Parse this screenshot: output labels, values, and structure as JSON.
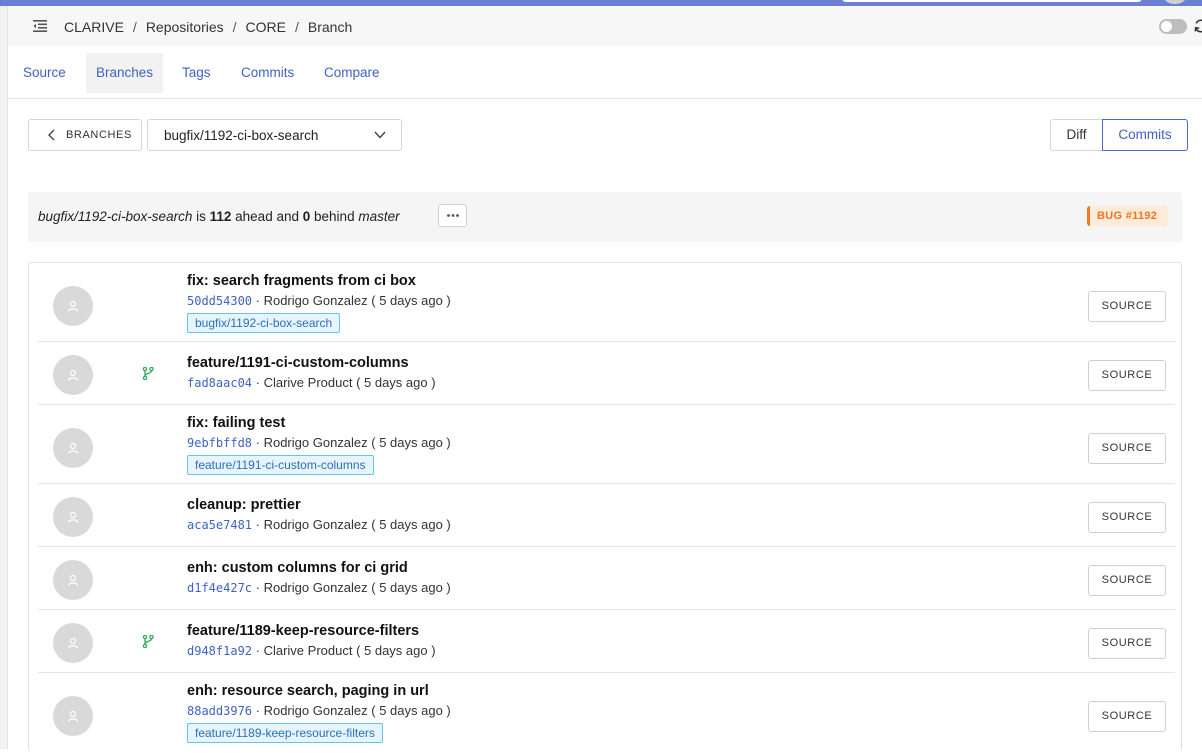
{
  "colors": {
    "accent": "#3f63c4",
    "bug_badge": "#ef7420",
    "tag_border": "#66c2ee",
    "merge_icon": "#2eaa5a"
  },
  "breadcrumb": [
    "CLARIVE",
    "Repositories",
    "CORE",
    "Branch"
  ],
  "tabs": [
    {
      "label": "Source",
      "active": false
    },
    {
      "label": "Branches",
      "active": true
    },
    {
      "label": "Tags",
      "active": false
    },
    {
      "label": "Commits",
      "active": false
    },
    {
      "label": "Compare",
      "active": false
    }
  ],
  "toolbar": {
    "back_label": "BRANCHES",
    "branch_selected": "bugfix/1192-ci-box-search",
    "view_diff": "Diff",
    "view_commits": "Commits",
    "active_view": "Commits"
  },
  "status": {
    "branch": "bugfix/1192-ci-box-search",
    "is_text": "is",
    "ahead": "112",
    "ahead_text": "ahead and",
    "behind": "0",
    "behind_text": "behind",
    "base": "master",
    "badge": "BUG #1192"
  },
  "commits": [
    {
      "title": "fix: search fragments from ci box",
      "hash": "50dd54300",
      "meta": " · Rodrigo Gonzalez ( 5 days ago )",
      "tag": "bugfix/1192-ci-box-search",
      "merge": false,
      "source_label": "SOURCE"
    },
    {
      "title": "feature/1191-ci-custom-columns",
      "hash": "fad8aac04",
      "meta": " · Clarive Product ( 5 days ago )",
      "tag": "",
      "merge": true,
      "source_label": "SOURCE"
    },
    {
      "title": "fix: failing test",
      "hash": "9ebfbffd8",
      "meta": " · Rodrigo Gonzalez ( 5 days ago )",
      "tag": "feature/1191-ci-custom-columns",
      "merge": false,
      "source_label": "SOURCE"
    },
    {
      "title": "cleanup: prettier",
      "hash": "aca5e7481",
      "meta": " · Rodrigo Gonzalez ( 5 days ago )",
      "tag": "",
      "merge": false,
      "source_label": "SOURCE"
    },
    {
      "title": "enh: custom columns for ci grid",
      "hash": "d1f4e427c",
      "meta": " · Rodrigo Gonzalez ( 5 days ago )",
      "tag": "",
      "merge": false,
      "source_label": "SOURCE"
    },
    {
      "title": "feature/1189-keep-resource-filters",
      "hash": "d948f1a92",
      "meta": " · Clarive Product ( 5 days ago )",
      "tag": "",
      "merge": true,
      "source_label": "SOURCE"
    },
    {
      "title": "enh: resource search, paging in url",
      "hash": "88add3976",
      "meta": " · Rodrigo Gonzalez ( 5 days ago )",
      "tag": "feature/1189-keep-resource-filters",
      "merge": false,
      "source_label": "SOURCE"
    }
  ]
}
